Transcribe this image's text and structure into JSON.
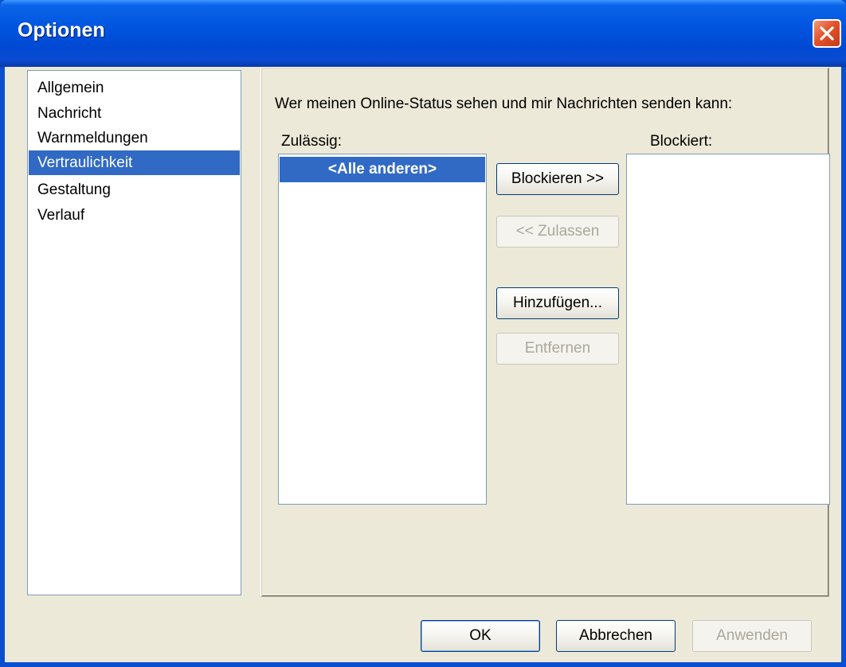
{
  "window": {
    "title": "Optionen"
  },
  "nav": {
    "items": [
      {
        "label": "Allgemein"
      },
      {
        "label": "Nachricht"
      },
      {
        "label": "Warnmeldungen"
      },
      {
        "label": "Vertraulichkeit"
      },
      {
        "label": "Gestaltung"
      },
      {
        "label": "Verlauf"
      }
    ],
    "selected_label": "Vertraulichkeit"
  },
  "privacy": {
    "heading": "Wer meinen Online-Status sehen und mir Nachrichten senden kann:",
    "allowed_label": "Zulässig:",
    "blocked_label": "Blockiert:",
    "allowed_items": [
      "<Alle anderen>"
    ],
    "blocked_items": [],
    "block_button": "Blockieren >>",
    "allow_button": "<< Zulassen",
    "add_button": "Hinzufügen...",
    "remove_button": "Entfernen"
  },
  "footer": {
    "ok": "OK",
    "cancel": "Abbrechen",
    "apply": "Anwenden"
  },
  "colors": {
    "titlebar": "#0155e0",
    "selection": "#316ac5",
    "window_bg": "#ece9d8",
    "close_button": "#e2532b"
  }
}
